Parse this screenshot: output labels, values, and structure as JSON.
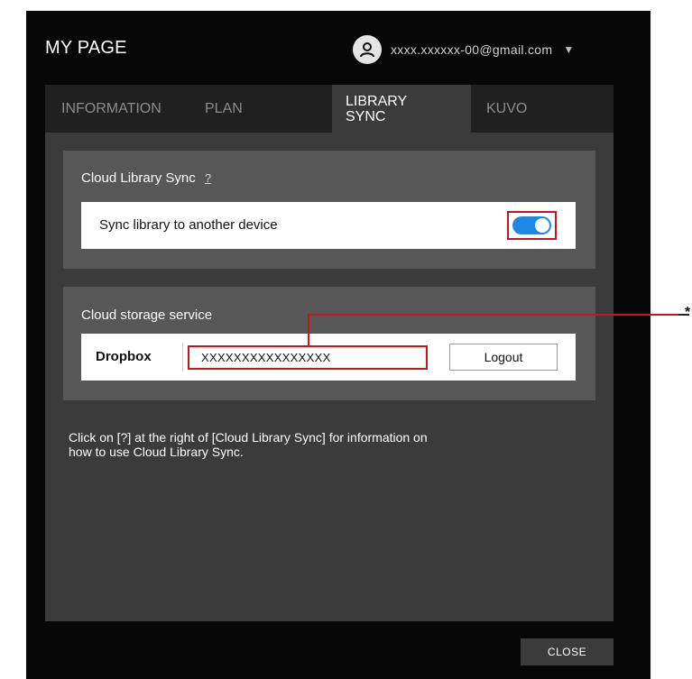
{
  "header": {
    "title": "MY PAGE",
    "user_email": "xxxx.xxxxxx-00@gmail.com",
    "avatar_icon": "user-icon",
    "dropdown_icon": "caret-down-icon"
  },
  "tabs": [
    {
      "label": "INFORMATION",
      "active": false
    },
    {
      "label": "PLAN",
      "active": false
    },
    {
      "label": "LIBRARY\nSYNC",
      "active": true
    },
    {
      "label": "KUVO",
      "active": false
    }
  ],
  "cloud_library_sync": {
    "title": "Cloud Library Sync",
    "help_link": "?",
    "sync_label": "Sync library to another device",
    "sync_enabled": true,
    "toggle_color": "#1e88e5"
  },
  "cloud_storage": {
    "title": "Cloud storage service",
    "provider": "Dropbox",
    "account": "XXXXXXXXXXXXXXXX",
    "logout_label": "Logout"
  },
  "info_text": "Click on [?] at the right of [Cloud Library Sync] for information on how to use Cloud Library Sync.",
  "footer": {
    "close_label": "CLOSE"
  },
  "annotation": {
    "mark": "*"
  },
  "colors": {
    "highlight": "#c4161c",
    "dialog_bg": "#070707",
    "content_bg": "#3b3b3b",
    "panel_bg": "#575757"
  }
}
